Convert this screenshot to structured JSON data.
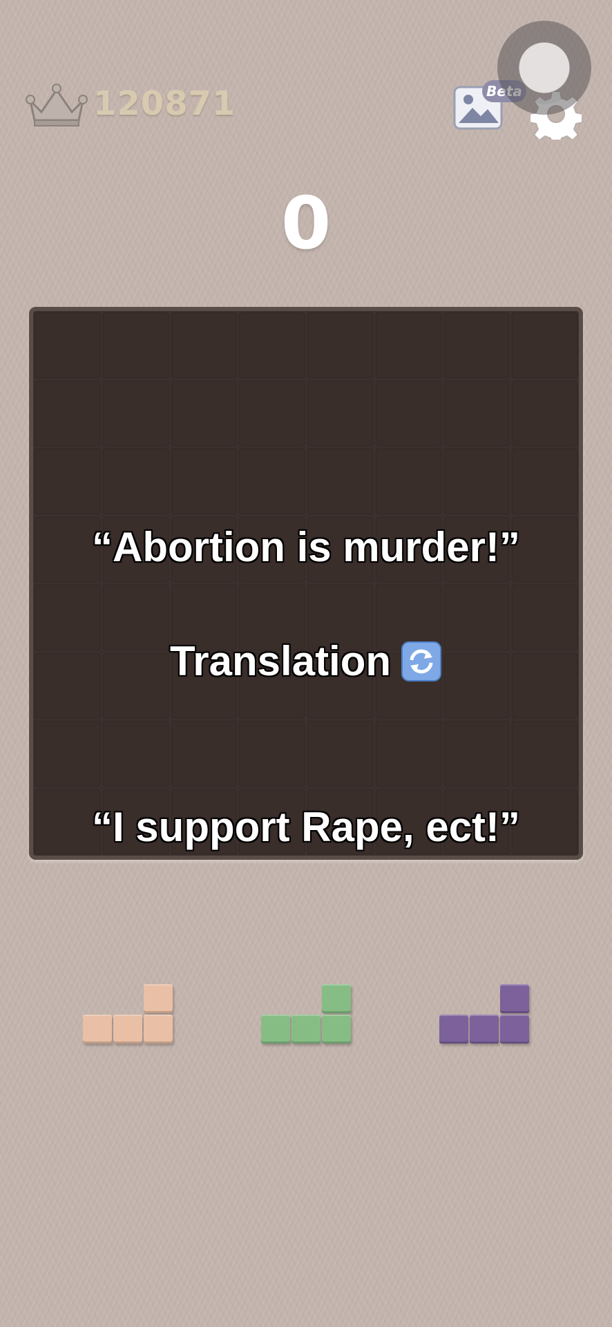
{
  "header": {
    "best_score": "120871",
    "current_score": "0",
    "beta_label": "Beta"
  },
  "icons": {
    "crown": "crown-icon",
    "image": "image-icon",
    "settings": "gear-icon",
    "assist": "assistive-touch-button",
    "refresh": "refresh-icon"
  },
  "captions": {
    "line1": "“Abortion is murder!”",
    "line2": "Translation",
    "line3": "“I support Rape, ect!”"
  },
  "pieces": [
    {
      "name": "peach-l-piece",
      "color": "#e9bfa5"
    },
    {
      "name": "green-l-piece",
      "color": "#86bd85"
    },
    {
      "name": "purple-l-piece",
      "color": "#7c619b"
    }
  ],
  "colors": {
    "board": "#3b302d",
    "background": "#c4b5ae",
    "best_score": "#d8cab0"
  }
}
